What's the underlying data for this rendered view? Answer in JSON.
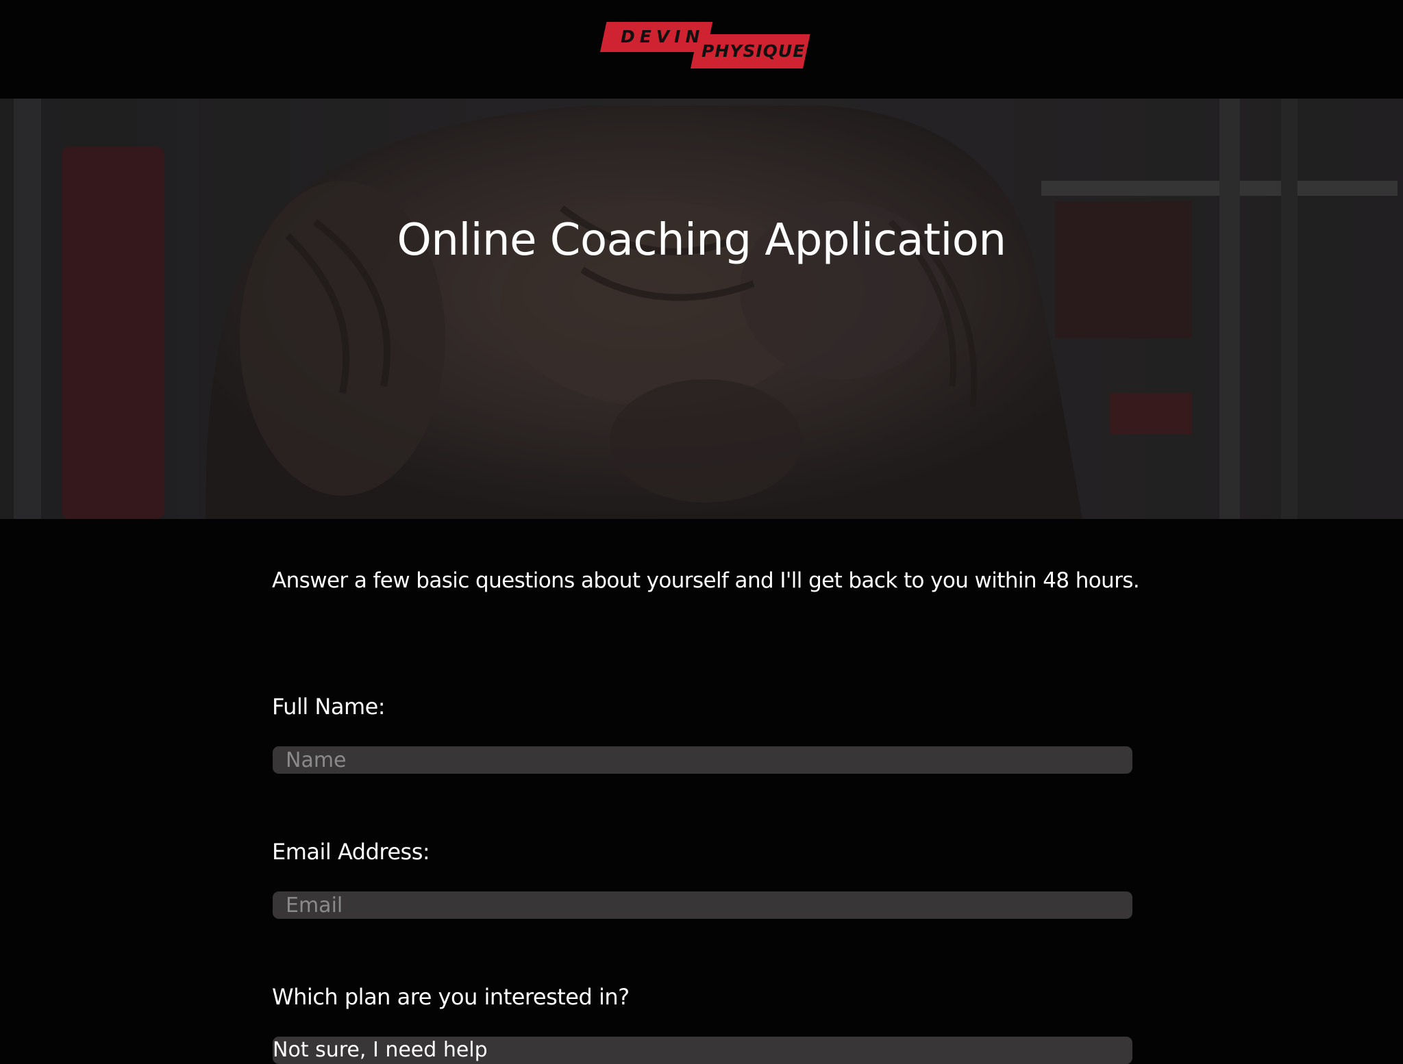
{
  "header": {
    "logo_line1": "DEVIN",
    "logo_line2": "PHYSIQUE",
    "logo_color": "#d02331"
  },
  "hero": {
    "title": "Online Coaching Application"
  },
  "form": {
    "intro": "Answer a few basic questions about yourself and I'll get back to you within 48 hours.",
    "full_name_label": "Full Name:",
    "full_name_placeholder": "Name",
    "email_label": "Email Address:",
    "email_placeholder": "Email",
    "plan_label": "Which plan are you interested in?",
    "plan_selected": "Not sure, I need help"
  }
}
